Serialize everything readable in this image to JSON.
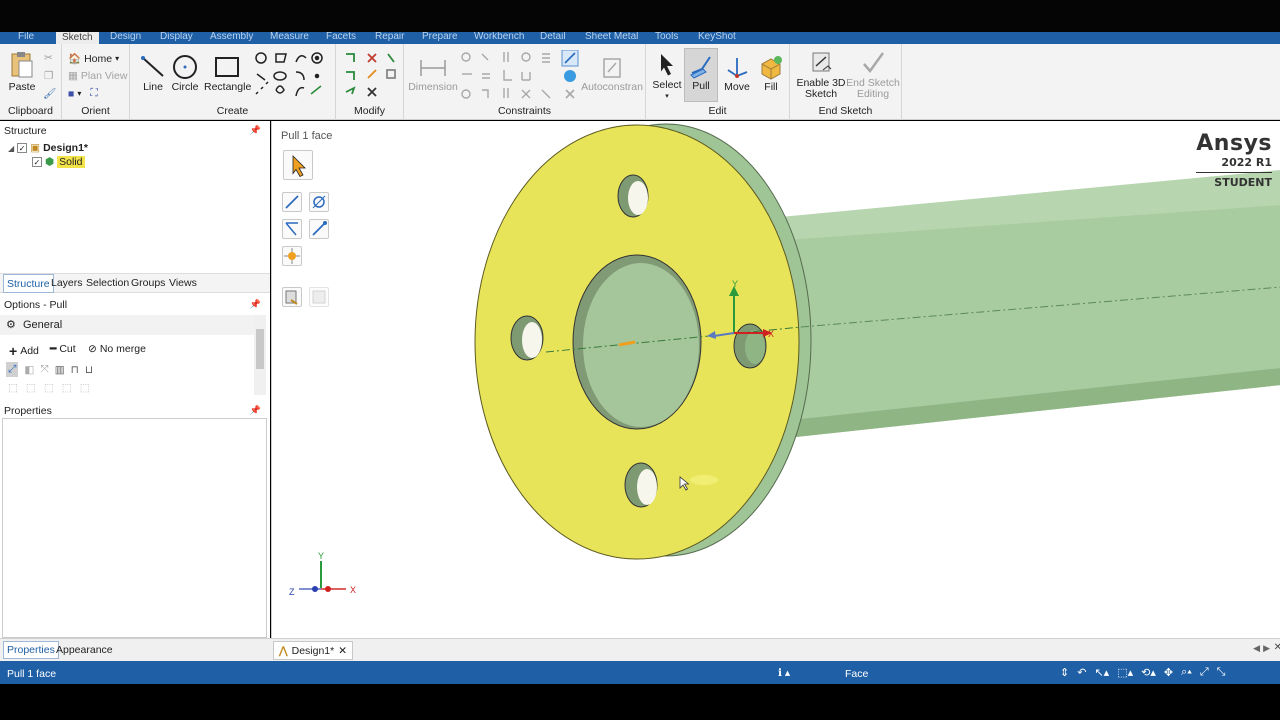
{
  "app_tabs": [
    "File",
    "Sketch",
    "Design",
    "Display",
    "Assembly",
    "Measure",
    "Facets",
    "Repair",
    "Prepare",
    "Workbench",
    "Detail",
    "Sheet Metal",
    "Tools",
    "KeyShot"
  ],
  "active_tab_index": 1,
  "ribbon": {
    "clipboard": {
      "label": "Clipboard",
      "paste": "Paste"
    },
    "orient": {
      "label": "Orient",
      "home": "Home",
      "plan_view": "Plan View"
    },
    "create": {
      "label": "Create",
      "line": "Line",
      "circle": "Circle",
      "rectangle": "Rectangle"
    },
    "modify": {
      "label": "Modify"
    },
    "constraints": {
      "label": "Constraints",
      "dimension": "Dimension",
      "autoconstrain": "Autoconstran"
    },
    "edit": {
      "label": "Edit",
      "select": "Select",
      "pull": "Pull",
      "move": "Move",
      "fill": "Fill"
    },
    "end_sketch": {
      "label": "End Sketch",
      "enable_3d_line1": "Enable 3D",
      "enable_3d_line2": "Sketch",
      "end_edit_line1": "End Sketch",
      "end_edit_line2": "Editing"
    }
  },
  "structure": {
    "title": "Structure",
    "design": "Design1*",
    "solid": "Solid",
    "tabs": [
      "Structure",
      "Layers",
      "Selection",
      "Groups",
      "Views"
    ]
  },
  "options": {
    "title": "Options - Pull",
    "general": "General",
    "add": "Add",
    "cut": "Cut",
    "no_merge": "No merge"
  },
  "properties": {
    "title": "Properties"
  },
  "bottom_tabs": [
    "Properties",
    "Appearance"
  ],
  "viewport": {
    "hint": "Pull 1 face",
    "axis_labels": {
      "x": "X",
      "y": "Y",
      "z": "Z"
    },
    "brand_name": "Ansys",
    "brand_version": "2022 R1",
    "brand_edition": "STUDENT",
    "face_color": "#e8e45a",
    "body_color": "#a9cba0"
  },
  "document_tab": "Design1*",
  "status": {
    "left": "Pull 1 face",
    "center": "Face"
  },
  "colors": {
    "accent": "#1f5fa6"
  }
}
